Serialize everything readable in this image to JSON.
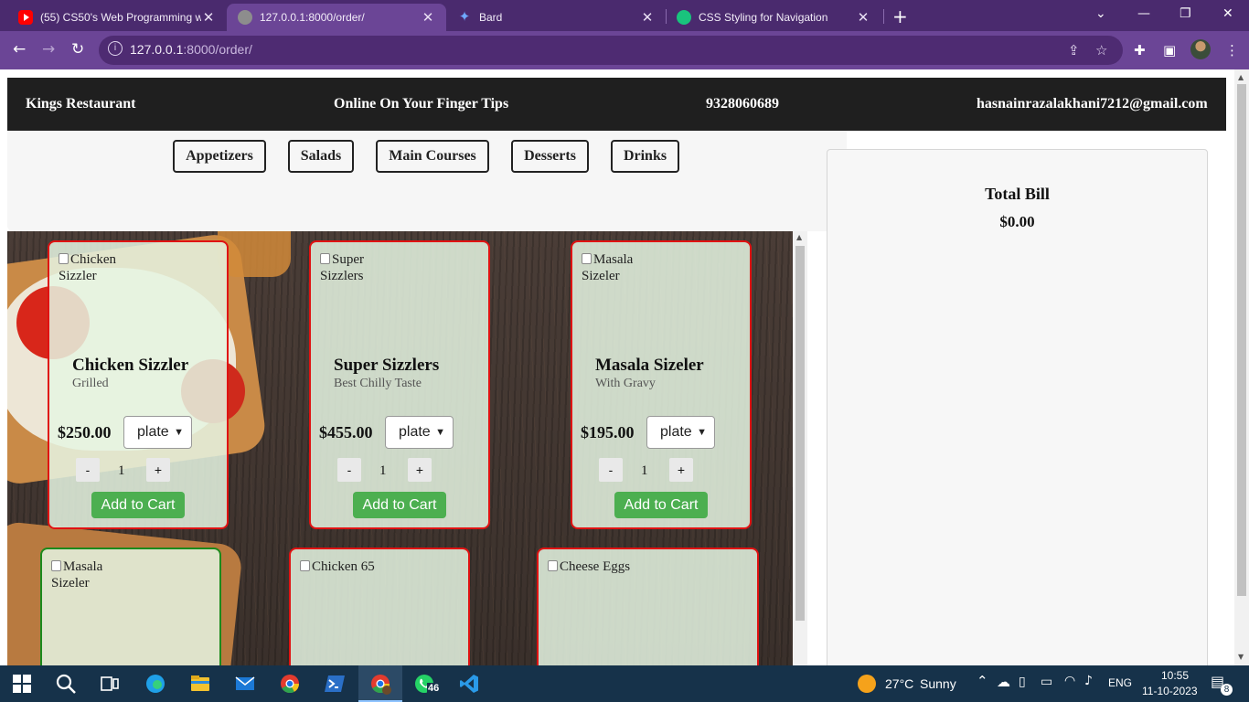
{
  "browser": {
    "tabs": [
      {
        "title": "(55) CS50's Web Programming w",
        "favicon": "youtube-icon"
      },
      {
        "title": "127.0.0.1:8000/order/",
        "favicon": "globe-icon",
        "active": true
      },
      {
        "title": "Bard",
        "favicon": "bard-sparkle-icon"
      },
      {
        "title": "CSS Styling for Navigation",
        "favicon": "chatgpt-icon"
      }
    ],
    "url_host": "127.0.0.1",
    "url_rest": ":8000/order/"
  },
  "header": {
    "brand": "Kings Restaurant",
    "tagline": "Online On Your Finger Tips",
    "phone": "9328060689",
    "email": "hasnainrazalakhani7212@gmail.com"
  },
  "menu_tabs": [
    "Appetizers",
    "Salads",
    "Main Courses",
    "Desserts",
    "Drinks"
  ],
  "cards": [
    {
      "alt": "Chicken Sizzler",
      "name": "Chicken Sizzler",
      "sub": "Grilled",
      "price": "$250.00",
      "unit": "plate",
      "qty": "1",
      "minus": "-",
      "plus": "+",
      "cart": "Add to Cart"
    },
    {
      "alt": "Super Sizzlers",
      "name": "Super Sizzlers",
      "sub": "Best Chilly Taste",
      "price": "$455.00",
      "unit": "plate",
      "qty": "1",
      "minus": "-",
      "plus": "+",
      "cart": "Add to Cart"
    },
    {
      "alt": "Masala Sizeler",
      "name": "Masala Sizeler",
      "sub": "With Gravy",
      "price": "$195.00",
      "unit": "plate",
      "qty": "1",
      "minus": "-",
      "plus": "+",
      "cart": "Add to Cart"
    },
    {
      "alt": "Masala Sizeler"
    },
    {
      "alt": "Chicken 65"
    },
    {
      "alt": "Cheese Eggs"
    }
  ],
  "bill": {
    "title": "Total Bill",
    "amount": "$0.00"
  },
  "taskbar": {
    "weather_temp": "27°C",
    "weather_text": "Sunny",
    "lang": "ENG",
    "time": "10:55",
    "date": "11-10-2023",
    "whatsapp_badge": "46",
    "notif_count": "8"
  },
  "colors": {
    "browser_frame": "#4a2a6e",
    "browser_toolbar": "#6b4596",
    "header_bg": "#1f1f1f",
    "card_border": "#e01212",
    "card_border_alt": "#1c8a1c",
    "cart_button": "#4caf50",
    "taskbar": "#16324a"
  }
}
